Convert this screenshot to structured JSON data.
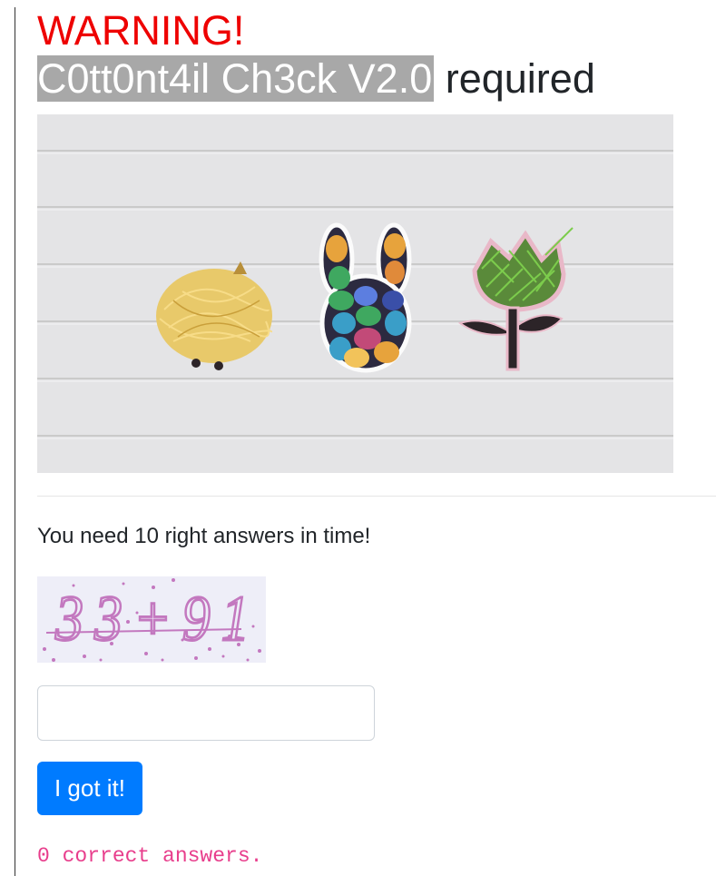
{
  "warning_text": "WARNING!",
  "title": {
    "highlight": "C0tt0nt4il Ch3ck V2.0",
    "rest": " required"
  },
  "hero_image": {
    "items": [
      "nest-cookie-cutter",
      "bunny-cookie-cutter-with-eggs",
      "tulip-cookie-cutter-with-grass"
    ],
    "colors": {
      "background": "#e4e4e6",
      "nest": "#e8c96a",
      "egg_colors": [
        "#e7a33c",
        "#3fa860",
        "#3a9ec8",
        "#c24a78",
        "#f2c35a"
      ],
      "grass": "#7ccc4c",
      "tulip_outline": "#e9b8c8",
      "leaf": "#2c2428"
    }
  },
  "instruction": "You need 10 right answers in time!",
  "captcha": {
    "text": "33+91",
    "color": "#c378bf",
    "background": "#eeeef8"
  },
  "answer_field": {
    "value": "",
    "placeholder": ""
  },
  "submit_label": "I got it!",
  "result_text": "0 correct answers."
}
